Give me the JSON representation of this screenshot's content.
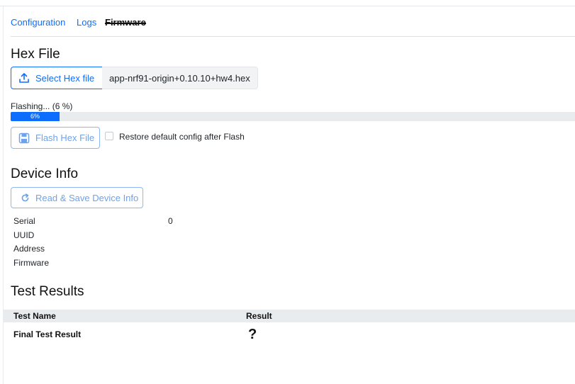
{
  "tabs": [
    {
      "label": "Configuration",
      "active": false
    },
    {
      "label": "Logs",
      "active": false
    },
    {
      "label": "Firmware",
      "active": true
    }
  ],
  "hex_file": {
    "title": "Hex File",
    "select_button": "Select Hex file",
    "filename": "app-nrf91-origin+0.10.10+hw4.hex",
    "progress_label": "Flashing... (6 %)",
    "progress_text": "6%",
    "progress_value": 6,
    "flash_button": "Flash Hex File",
    "restore_checkbox_label": "Restore default config after Flash",
    "restore_checked": false
  },
  "device_info": {
    "title": "Device Info",
    "read_button": "Read & Save Device Info",
    "rows": [
      {
        "label": "Serial",
        "value": "0"
      },
      {
        "label": "UUID",
        "value": ""
      },
      {
        "label": "Address",
        "value": ""
      },
      {
        "label": "Firmware",
        "value": ""
      }
    ]
  },
  "test_results": {
    "title": "Test Results",
    "columns": [
      "Test Name",
      "Result"
    ],
    "rows": [
      {
        "name": "Final Test Result",
        "result": "?"
      }
    ]
  },
  "colors": {
    "accent": "#0d6efd",
    "accent_disabled": "#6ea2ec",
    "header_bg": "#e9ecef"
  },
  "icons": {
    "select_hex": "upload-icon",
    "flash": "save-icon",
    "read_device": "refresh-icon"
  }
}
